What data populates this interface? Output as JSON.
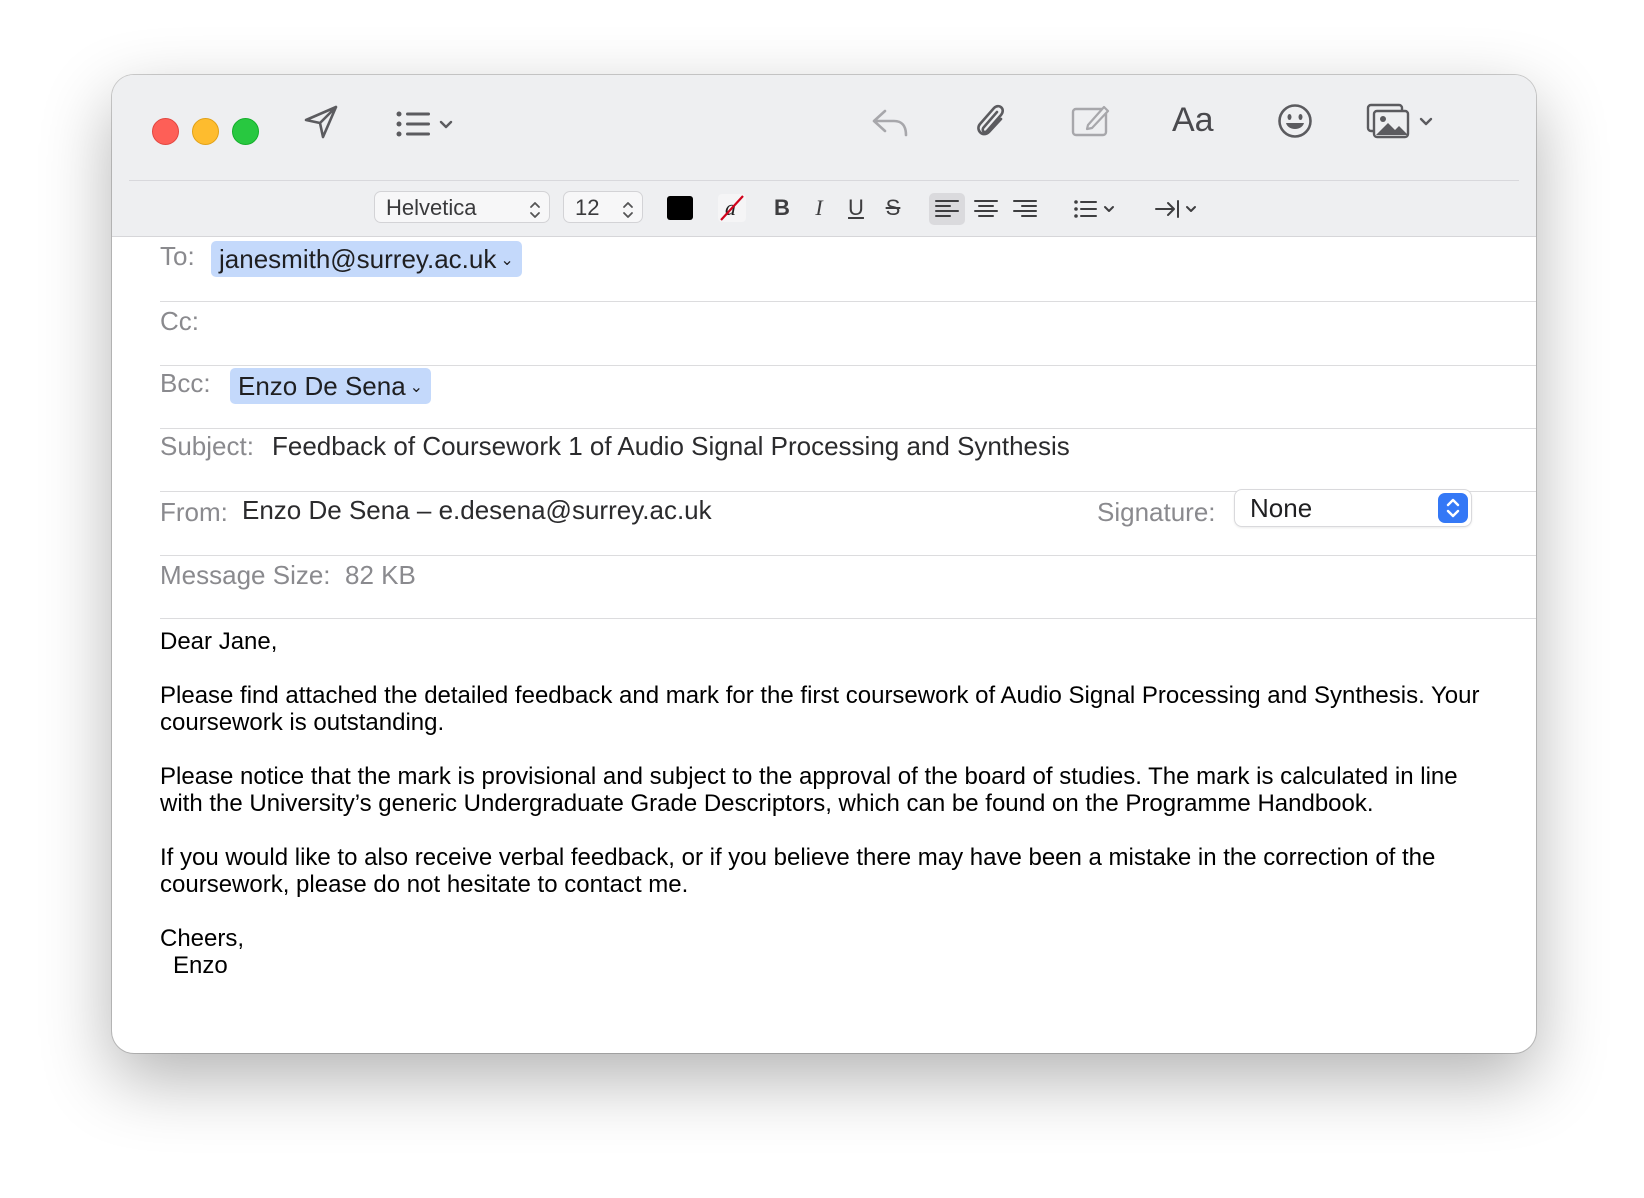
{
  "toolbar": {
    "icons": [
      "send-icon",
      "header-fields-icon",
      "reply-icon",
      "attachment-icon",
      "markup-icon",
      "format-icon",
      "emoji-icon",
      "photo-browser-icon"
    ],
    "format_label": "Aa"
  },
  "format_bar": {
    "font": "Helvetica",
    "size": "12",
    "text_color": "#000000",
    "bold": "B",
    "italic": "I",
    "underline": "U",
    "strikethrough": "S",
    "highlight_glyph": "a",
    "active_alignment": "left"
  },
  "header": {
    "to_label": "To:",
    "to_recipient": "janesmith@surrey.ac.uk",
    "cc_label": "Cc:",
    "bcc_label": "Bcc:",
    "bcc_recipient": "Enzo De Sena",
    "subject_label": "Subject:",
    "subject": "Feedback of Coursework 1 of Audio Signal Processing and Synthesis",
    "from_label": "From:",
    "from": "Enzo De Sena – e.desena@surrey.ac.uk",
    "signature_label": "Signature:",
    "signature_value": "None",
    "message_size_label": "Message Size:",
    "message_size": "82 KB"
  },
  "body": {
    "greeting": "Dear Jane,",
    "p1": "Please find attached the detailed feedback and mark for the first coursework of Audio Signal Processing and Synthesis. Your coursework is outstanding.",
    "p2": "Please notice that the mark is provisional and subject to the approval of the board of studies. The mark is calculated in line with the University’s generic Undergraduate Grade Descriptors, which can be found on the Programme Handbook.",
    "p3": "If you would like to also receive verbal feedback, or if you believe there may have been a mistake in the correction of the coursework, please do not hesitate to contact me.",
    "closing": "Cheers,",
    "signoff": "Enzo"
  },
  "colors": {
    "token_bg": "#c4d9fb",
    "accent": "#3478f6",
    "close": "#fe5f57",
    "minimize": "#febc2e",
    "zoom": "#28c840"
  }
}
